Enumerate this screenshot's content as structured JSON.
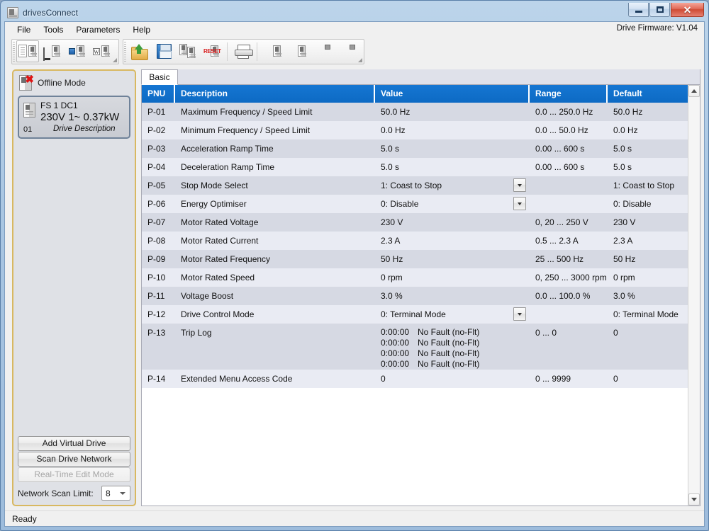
{
  "window": {
    "title": "drivesConnect",
    "title_icon": "drive-icon",
    "buttons": {
      "minimize": "minimize-icon",
      "maximize": "maximize-icon",
      "close": "✕"
    }
  },
  "menubar": {
    "items": [
      {
        "label": "File"
      },
      {
        "label": "Tools"
      },
      {
        "label": "Parameters"
      },
      {
        "label": "Help"
      }
    ],
    "firmware": "Drive Firmware: V1.04"
  },
  "toolbar": {
    "groups": [
      {
        "name": "view-group",
        "buttons": [
          {
            "name": "compare-view-button",
            "icon": "two-page-compare-icon",
            "selected": true
          },
          {
            "name": "monitor-drive-button",
            "icon": "monitor-drive-icon",
            "selected": false
          },
          {
            "name": "scope-drive-button",
            "icon": "scope-drive-icon",
            "selected": false
          },
          {
            "name": "wizard-drive-button",
            "icon": "wizard-drive-icon",
            "selected": false
          }
        ]
      },
      {
        "name": "file-group",
        "buttons": [
          {
            "name": "open-button",
            "icon": "open-folder-icon",
            "selected": false
          },
          {
            "name": "save-button",
            "icon": "save-floppy-icon",
            "selected": false
          },
          {
            "name": "copy-parameters-button",
            "icon": "copy-drives-icon",
            "selected": false
          },
          {
            "name": "reset-parameters-button",
            "icon": "reset-drive-icon",
            "selected": false
          },
          {
            "name": "print-button",
            "icon": "printer-icon",
            "selected": false
          },
          {
            "name": "read-from-drive-button",
            "icon": "green-left-arrow-drive-icon",
            "selected": false
          },
          {
            "name": "write-to-drive-button",
            "icon": "red-right-arrow-drive-icon",
            "selected": false
          },
          {
            "name": "read-from-usb-button",
            "icon": "green-arrow-usb-icon",
            "selected": false
          },
          {
            "name": "write-to-usb-button",
            "icon": "red-arrow-usb-icon",
            "selected": false
          }
        ]
      }
    ],
    "reset_label": "RESET"
  },
  "sidebar": {
    "offline": {
      "label": "Offline Mode",
      "icon": "offline-drive-icon"
    },
    "drive": {
      "icon": "drive-icon",
      "line1": "FS 1  DC1",
      "line2": "230V 1~  0.37kW",
      "number": "01",
      "description": "Drive Description"
    },
    "buttons": [
      {
        "name": "add-virtual-drive-button",
        "label": "Add Virtual Drive",
        "disabled": false
      },
      {
        "name": "scan-drive-network-button",
        "label": "Scan Drive Network",
        "disabled": false
      },
      {
        "name": "real-time-edit-mode-button",
        "label": "Real-Time Edit Mode",
        "disabled": true
      }
    ],
    "scan_limit": {
      "label": "Network Scan Limit:",
      "value": "8"
    }
  },
  "tabs": [
    {
      "name": "tab-basic",
      "label": "Basic",
      "active": true
    }
  ],
  "grid": {
    "columns": [
      "PNU",
      "Description",
      "Value",
      "Range",
      "Default"
    ],
    "rows": [
      {
        "pnu": "P-01",
        "description": "Maximum Frequency / Speed Limit",
        "value": "50.0 Hz",
        "range": "0.0 ... 250.0 Hz",
        "default": "50.0 Hz",
        "dropdown": false
      },
      {
        "pnu": "P-02",
        "description": "Minimum Frequency / Speed Limit",
        "value": "0.0 Hz",
        "range": "0.0 ... 50.0 Hz",
        "default": "0.0 Hz",
        "dropdown": false
      },
      {
        "pnu": "P-03",
        "description": "Acceleration Ramp Time",
        "value": "5.0 s",
        "range": "0.00 ... 600 s",
        "default": "5.0 s",
        "dropdown": false
      },
      {
        "pnu": "P-04",
        "description": "Deceleration Ramp Time",
        "value": "5.0 s",
        "range": "0.00 ... 600 s",
        "default": "5.0 s",
        "dropdown": false
      },
      {
        "pnu": "P-05",
        "description": "Stop Mode Select",
        "value": "1: Coast to Stop",
        "range": "",
        "default": "1: Coast to Stop",
        "dropdown": true
      },
      {
        "pnu": "P-06",
        "description": "Energy Optimiser",
        "value": "0: Disable",
        "range": "",
        "default": "0: Disable",
        "dropdown": true
      },
      {
        "pnu": "P-07",
        "description": "Motor Rated Voltage",
        "value": "230 V",
        "range": "0, 20 ... 250 V",
        "default": "230 V",
        "dropdown": false
      },
      {
        "pnu": "P-08",
        "description": "Motor Rated Current",
        "value": "2.3 A",
        "range": "0.5 ... 2.3 A",
        "default": "2.3 A",
        "dropdown": false
      },
      {
        "pnu": "P-09",
        "description": "Motor Rated Frequency",
        "value": "50 Hz",
        "range": "25 ... 500 Hz",
        "default": "50 Hz",
        "dropdown": false
      },
      {
        "pnu": "P-10",
        "description": "Motor Rated Speed",
        "value": "0 rpm",
        "range": "0, 250 ... 3000 rpm",
        "default": "0 rpm",
        "dropdown": false
      },
      {
        "pnu": "P-11",
        "description": "Voltage Boost",
        "value": "3.0 %",
        "range": "0.0 ... 100.0 %",
        "default": "3.0 %",
        "dropdown": false
      },
      {
        "pnu": "P-12",
        "description": "Drive Control Mode",
        "value": "0: Terminal Mode",
        "range": "",
        "default": "0: Terminal Mode",
        "dropdown": true
      },
      {
        "pnu": "P-13",
        "description": "Trip Log",
        "value": "",
        "range": "0 ... 0",
        "default": "0",
        "dropdown": false,
        "trip_log": [
          {
            "time": "0:00:00",
            "fault": "No Fault (no-Flt)"
          },
          {
            "time": "0:00:00",
            "fault": "No Fault (no-Flt)"
          },
          {
            "time": "0:00:00",
            "fault": "No Fault (no-Flt)"
          },
          {
            "time": "0:00:00",
            "fault": "No Fault (no-Flt)"
          }
        ]
      },
      {
        "pnu": "P-14",
        "description": "Extended Menu Access Code",
        "value": "0",
        "range": "0 ... 9999",
        "default": "0",
        "dropdown": false
      }
    ]
  },
  "statusbar": {
    "text": "Ready"
  }
}
